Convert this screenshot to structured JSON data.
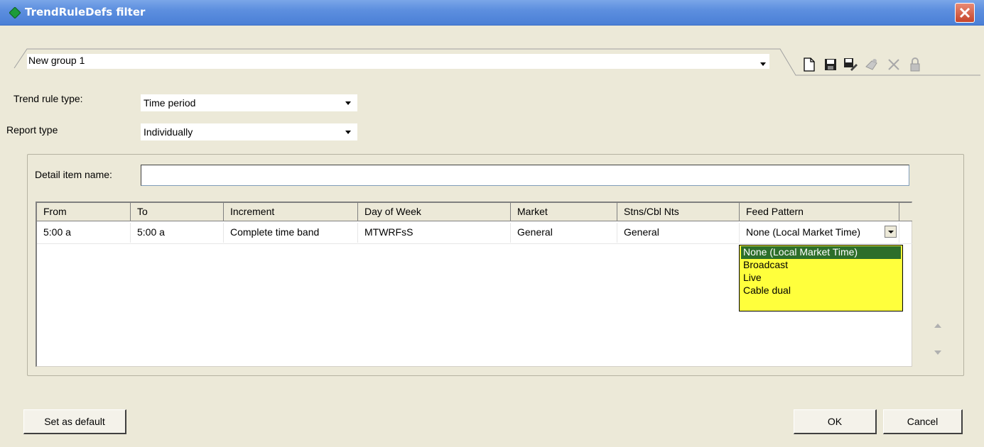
{
  "window": {
    "title": "TrendRuleDefs filter"
  },
  "group": {
    "value": "New group 1"
  },
  "toolbar": [
    "new-document-icon",
    "save-icon",
    "save-as-icon",
    "rename-icon",
    "delete-icon",
    "lock-icon"
  ],
  "trend_rule_type": {
    "label": "Trend rule type:",
    "value": "Time period"
  },
  "report_type": {
    "label": "Report type",
    "value": "Individually"
  },
  "detail_item": {
    "label": "Detail item name:",
    "value": ""
  },
  "grid": {
    "columns": [
      "From",
      "To",
      "Increment",
      "Day of Week",
      "Market",
      "Stns/Cbl Nts",
      "Feed Pattern"
    ],
    "rows": [
      {
        "from": "5:00 a",
        "to": "5:00 a",
        "increment": "Complete time band",
        "day_of_week": "MTWRFsS",
        "market": "General",
        "stations": "General",
        "feed_pattern": "None (Local Market Time)"
      }
    ]
  },
  "feed_pattern_options": [
    "None (Local Market Time)",
    "Broadcast",
    "Live",
    "Cable dual"
  ],
  "buttons": {
    "set_default": "Set as default",
    "ok": "OK",
    "cancel": "Cancel"
  },
  "colors": {
    "dropdown_bg": "#ffff3c",
    "dropdown_selected": "#2d6e2a",
    "titlebar": "#5d8fdf"
  }
}
